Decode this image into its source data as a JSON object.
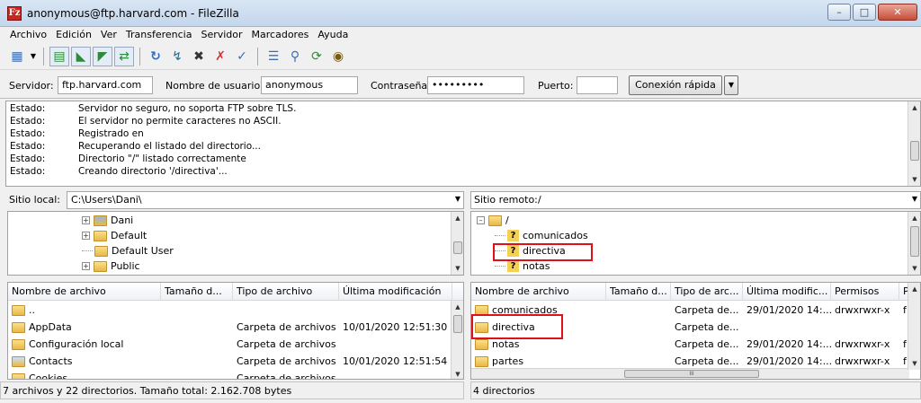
{
  "window": {
    "title": "anonymous@ftp.harvard.com - FileZilla",
    "app_icon": "Fz"
  },
  "menu": [
    "Archivo",
    "Edición",
    "Ver",
    "Transferencia",
    "Servidor",
    "Marcadores",
    "Ayuda"
  ],
  "quickconnect": {
    "host_label": "Servidor:",
    "host_value": "ftp.harvard.com",
    "user_label": "Nombre de usuario:",
    "user_value": "anonymous",
    "pass_label": "Contraseña:",
    "pass_value": "•••••••••",
    "port_label": "Puerto:",
    "port_value": "",
    "connect_button": "Conexión rápida",
    "dropdown_arrow": "▼"
  },
  "log": [
    {
      "label": "Estado:",
      "message": "Servidor no seguro, no soporta FTP sobre TLS."
    },
    {
      "label": "Estado:",
      "message": "El servidor no permite caracteres no ASCII."
    },
    {
      "label": "Estado:",
      "message": "Registrado en"
    },
    {
      "label": "Estado:",
      "message": "Recuperando el listado del directorio..."
    },
    {
      "label": "Estado:",
      "message": "Directorio \"/\" listado correctamente"
    },
    {
      "label": "Estado:",
      "message": "Creando directorio '/directiva'..."
    }
  ],
  "local": {
    "site_label": "Sitio local:",
    "site_path": "C:\\Users\\Dani\\",
    "tree": [
      {
        "name": "Dani",
        "expander": "+",
        "user_folder": true
      },
      {
        "name": "Default",
        "expander": "+"
      },
      {
        "name": "Default User",
        "expander": ""
      },
      {
        "name": "Public",
        "expander": "+"
      }
    ],
    "columns": [
      "Nombre de archivo",
      "Tamaño d...",
      "Tipo de archivo",
      "Última modificación"
    ],
    "rows": [
      {
        "name": "..",
        "size": "",
        "type": "",
        "modified": ""
      },
      {
        "name": "AppData",
        "size": "",
        "type": "Carpeta de archivos",
        "modified": "10/01/2020 12:51:30"
      },
      {
        "name": "Configuración local",
        "size": "",
        "type": "Carpeta de archivos",
        "modified": ""
      },
      {
        "name": "Contacts",
        "size": "",
        "type": "Carpeta de archivos",
        "modified": "10/01/2020 12:51:54"
      },
      {
        "name": "Cookies",
        "size": "",
        "type": "Carpeta de archivos",
        "modified": ""
      }
    ],
    "status": "7 archivos y 22 directorios. Tamaño total: 2.162.708 bytes"
  },
  "remote": {
    "site_label": "Sitio remoto:",
    "site_path": "/",
    "tree_root": "/",
    "tree": [
      {
        "name": "comunicados"
      },
      {
        "name": "directiva"
      },
      {
        "name": "notas"
      }
    ],
    "columns": [
      "Nombre de archivo",
      "Tamaño d...",
      "Tipo de arc...",
      "Última modific...",
      "Permisos",
      "P"
    ],
    "rows": [
      {
        "name": "comunicados",
        "size": "",
        "type": "Carpeta de...",
        "modified": "29/01/2020 14:...",
        "perms": "drwxrwxr-x",
        "owner": "f"
      },
      {
        "name": "directiva",
        "size": "",
        "type": "Carpeta de...",
        "modified": "",
        "perms": "",
        "owner": ""
      },
      {
        "name": "notas",
        "size": "",
        "type": "Carpeta de...",
        "modified": "29/01/2020 14:...",
        "perms": "drwxrwxr-x",
        "owner": "f"
      },
      {
        "name": "partes",
        "size": "",
        "type": "Carpeta de...",
        "modified": "29/01/2020 14:...",
        "perms": "drwxrwxr-x",
        "owner": "f"
      }
    ],
    "status": "4 directorios",
    "hscroll_grip": "III"
  },
  "colors": {
    "highlight": "#e0101a",
    "titlebar": "#c3d6ec",
    "folder": "#e9b844"
  }
}
